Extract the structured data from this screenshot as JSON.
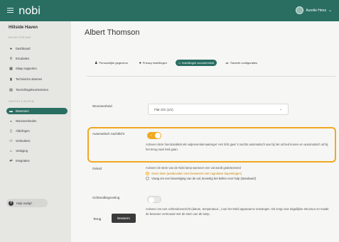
{
  "topbar": {
    "logo": "nobi",
    "user_name": "Aurelie Hens",
    "user_chevron": "⌄"
  },
  "sidebar": {
    "location": "Hillside Haven",
    "monitoring_header": "MONITORING",
    "monitoring_items": [
      {
        "label": "Dashboard",
        "icon": "dashboard-icon",
        "glyph": "●"
      },
      {
        "label": "Escalaties",
        "icon": "pin-icon",
        "glyph": "⚲"
      },
      {
        "label": "Slaap rapporten",
        "icon": "calendar-icon",
        "glyph": "▦"
      },
      {
        "label": "Technische alarmen",
        "icon": "device-icon",
        "glyph": "▮"
      },
      {
        "label": "Toezichtsgebeurtenissen",
        "icon": "table-icon",
        "glyph": "▤"
      }
    ],
    "instellingen_header": "INSTELLINGEN",
    "instellingen_items": [
      {
        "label": "Bewoners",
        "icon": "residents-icon",
        "glyph": "▬",
        "active": true
      },
      {
        "label": "Wooneenheden",
        "icon": "unit-icon",
        "glyph": "◒"
      },
      {
        "label": "Afdelingen",
        "icon": "building-icon",
        "glyph": "▯"
      },
      {
        "label": "Gebruikers",
        "icon": "users-icon",
        "glyph": "⚇"
      },
      {
        "label": "Vestiging",
        "icon": "home-icon",
        "glyph": "⌂"
      },
      {
        "label": "Integraties",
        "icon": "swap-icon",
        "glyph": "⇄"
      }
    ],
    "help": {
      "label": "Hulp nodig?",
      "glyph": "?"
    }
  },
  "main": {
    "title": "Albert Thomson",
    "tabs": [
      {
        "label": "Persoonlijke gegevens",
        "icon": "person-icon",
        "glyph": "♟"
      },
      {
        "label": "Privacy instellingen",
        "icon": "privacy-icon",
        "glyph": "●"
      },
      {
        "label": "Instellingen wooneenheid",
        "icon": "home-icon",
        "glyph": "⌂",
        "active": true
      },
      {
        "label": "Toezicht configuraties",
        "icon": "sliders-icon",
        "glyph": "⚌"
      }
    ],
    "wooneenheid": {
      "label": "Wooneenheid",
      "selected_value": "Flat 101 (1/1)"
    },
    "nachtlicht": {
      "label": "Automatisch nachtlicht",
      "toggle_state": "on",
      "toggle_mark": "✓",
      "description": "Activeer deze functionaliteit als valpreventiemaatregel. Het licht gaat 's nachts automatisch aan bij het uit bed komen en automatisch uit bij het terug naar bed gaan."
    },
    "geluid": {
      "label": "Geluid",
      "description": "Activeer de stem van de Nobi lamp wanneer een val wordt gedetecteerd",
      "options": [
        {
          "label": "Geen stem (aanbevolen voor bewoners met cognitieve beperkingen)",
          "checked": true
        },
        {
          "label": "Vraag om een bevestiging van de val, bevestig het bellen voor hulp (standaard)",
          "checked": false
        }
      ]
    },
    "ochtend": {
      "label": "Ochtendbegroeting",
      "toggle_state": "off",
      "description": "Activeer om een ochtendoverzicht (datum, temperatuur...) van het Nobi apparaat te ontvangen. Dit zorgt voor dagelijkse structuur en maakt de bewoner vertrouwd met de stem van de lamp."
    },
    "actions": {
      "back_label": "Terug",
      "save_label": "Bewaren"
    }
  },
  "colors": {
    "brand": "#2a6e62",
    "accent": "#efa821",
    "dark_button": "#3a3a3a"
  }
}
